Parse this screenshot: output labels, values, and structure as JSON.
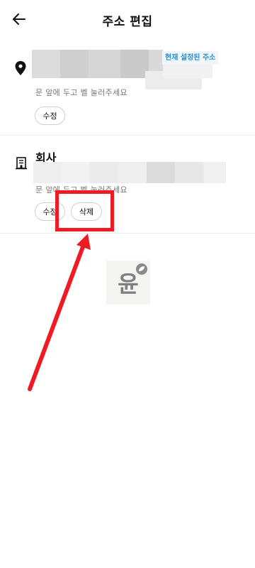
{
  "header": {
    "title": "주소 편집",
    "back_icon": "arrow-left-icon"
  },
  "addresses": [
    {
      "icon": "map-pin-icon",
      "badge": "현재 설정된 주소",
      "hint": "문 앞에 두고 벨 눌러주세요",
      "edit_label": "수정"
    },
    {
      "icon": "building-icon",
      "name": "회사",
      "hint": "문 앞에 두고 벨 눌러주세요",
      "edit_label": "수정",
      "delete_label": "삭제"
    }
  ],
  "annotation": {
    "color": "#ee1b24"
  },
  "watermark": {
    "text": "윤"
  },
  "colors": {
    "badge_text": "#2c8fd6",
    "badge_bg": "#f1f6fb",
    "hint_text": "#777777",
    "annotation_red": "#ee1b24"
  }
}
